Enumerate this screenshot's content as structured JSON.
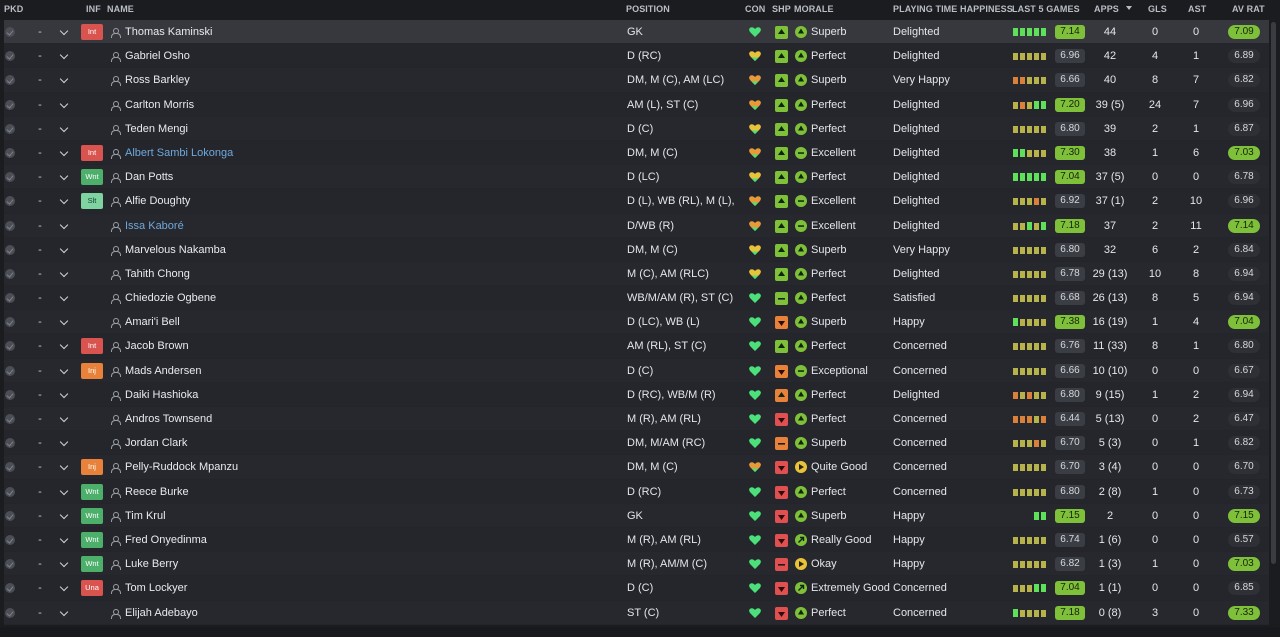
{
  "colors": {
    "green": "#7ec03a",
    "good_heart": "#4be07a",
    "ok_heart": "#e8c23a",
    "poor_heart": "#e89a3a",
    "red": "#e05050",
    "orange": "#e8823a",
    "yellow": "#e8c23a"
  },
  "headers": {
    "pkd": "PKD",
    "inf": "INF",
    "name": "NAME",
    "position": "POSITION",
    "con": "CON",
    "shp": "SHP",
    "morale": "MORALE",
    "playing_time": "PLAYING TIME HAPPINESS",
    "last5": "LAST 5 GAMES",
    "apps": "APPS",
    "gls": "GLS",
    "ast": "AST",
    "avrat": "AV RAT"
  },
  "players": [
    {
      "pkd": "-",
      "inf": "Int",
      "name": "Thomas Kaminski",
      "link": false,
      "position": "GK",
      "con": "good",
      "shp": "good",
      "morale_icon": "up",
      "morale": "Superb",
      "pth": "Delighted",
      "last5": [
        2,
        2,
        2,
        2,
        2
      ],
      "last5_rating": "7.14",
      "last5_hi": true,
      "apps": "44",
      "gls": "0",
      "ast": "0",
      "avrat": "7.09",
      "avrat_hi": true
    },
    {
      "pkd": "-",
      "inf": "",
      "name": "Gabriel Osho",
      "link": false,
      "position": "D (RC)",
      "con": "ok",
      "shp": "good",
      "morale_icon": "up",
      "morale": "Perfect",
      "pth": "Delighted",
      "last5": [
        1,
        1,
        1,
        1,
        1
      ],
      "last5_rating": "6.96",
      "last5_hi": false,
      "apps": "42",
      "gls": "4",
      "ast": "1",
      "avrat": "6.89",
      "avrat_hi": false
    },
    {
      "pkd": "-",
      "inf": "",
      "name": "Ross Barkley",
      "link": false,
      "position": "DM, M (C), AM (LC)",
      "con": "poor",
      "shp": "good",
      "morale_icon": "up",
      "morale": "Superb",
      "pth": "Very Happy",
      "last5": [
        0,
        0,
        1,
        1,
        1
      ],
      "last5_rating": "6.66",
      "last5_hi": false,
      "apps": "40",
      "gls": "8",
      "ast": "7",
      "avrat": "6.82",
      "avrat_hi": false
    },
    {
      "pkd": "-",
      "inf": "",
      "name": "Carlton Morris",
      "link": false,
      "position": "AM (L), ST (C)",
      "con": "poor",
      "shp": "good",
      "morale_icon": "up",
      "morale": "Perfect",
      "pth": "Delighted",
      "last5": [
        1,
        0,
        1,
        2,
        2
      ],
      "last5_rating": "7.20",
      "last5_hi": true,
      "apps": "39 (5)",
      "gls": "24",
      "ast": "7",
      "avrat": "6.96",
      "avrat_hi": false
    },
    {
      "pkd": "-",
      "inf": "",
      "name": "Teden Mengi",
      "link": false,
      "position": "D (C)",
      "con": "ok",
      "shp": "good",
      "morale_icon": "up",
      "morale": "Perfect",
      "pth": "Delighted",
      "last5": [
        1,
        1,
        1,
        1,
        1
      ],
      "last5_rating": "6.80",
      "last5_hi": false,
      "apps": "39",
      "gls": "2",
      "ast": "1",
      "avrat": "6.87",
      "avrat_hi": false
    },
    {
      "pkd": "-",
      "inf": "Int",
      "name": "Albert Sambi Lokonga",
      "link": true,
      "position": "DM, M (C)",
      "con": "poor",
      "shp": "good",
      "morale_icon": "flat",
      "morale": "Excellent",
      "pth": "Delighted",
      "last5": [
        2,
        2,
        1,
        1,
        1
      ],
      "last5_rating": "7.30",
      "last5_hi": true,
      "apps": "38",
      "gls": "1",
      "ast": "6",
      "avrat": "7.03",
      "avrat_hi": true
    },
    {
      "pkd": "-",
      "inf": "Wnt",
      "name": "Dan Potts",
      "link": false,
      "position": "D (LC)",
      "con": "ok",
      "shp": "good",
      "morale_icon": "up",
      "morale": "Perfect",
      "pth": "Delighted",
      "last5": [
        2,
        2,
        2,
        2,
        2
      ],
      "last5_rating": "7.04",
      "last5_hi": true,
      "apps": "37 (5)",
      "gls": "0",
      "ast": "0",
      "avrat": "6.78",
      "avrat_hi": false
    },
    {
      "pkd": "-",
      "inf": "Slt",
      "name": "Alfie Doughty",
      "link": false,
      "position": "D (L), WB (RL), M (L),…",
      "con": "poor",
      "shp": "good",
      "morale_icon": "flat",
      "morale": "Excellent",
      "pth": "Delighted",
      "last5": [
        1,
        1,
        1,
        0,
        1
      ],
      "last5_rating": "6.92",
      "last5_hi": false,
      "apps": "37 (1)",
      "gls": "2",
      "ast": "10",
      "avrat": "6.96",
      "avrat_hi": false
    },
    {
      "pkd": "-",
      "inf": "",
      "name": "Issa Kaboré",
      "link": true,
      "position": "D/WB (R)",
      "con": "poor",
      "shp": "good",
      "morale_icon": "flat",
      "morale": "Excellent",
      "pth": "Delighted",
      "last5": [
        1,
        1,
        2,
        1,
        2
      ],
      "last5_rating": "7.18",
      "last5_hi": true,
      "apps": "37",
      "gls": "2",
      "ast": "11",
      "avrat": "7.14",
      "avrat_hi": true
    },
    {
      "pkd": "-",
      "inf": "",
      "name": "Marvelous Nakamba",
      "link": false,
      "position": "DM, M (C)",
      "con": "ok",
      "shp": "good",
      "morale_icon": "up",
      "morale": "Superb",
      "pth": "Very Happy",
      "last5": [
        1,
        1,
        1,
        1,
        1
      ],
      "last5_rating": "6.80",
      "last5_hi": false,
      "apps": "32",
      "gls": "6",
      "ast": "2",
      "avrat": "6.84",
      "avrat_hi": false
    },
    {
      "pkd": "-",
      "inf": "",
      "name": "Tahith Chong",
      "link": false,
      "position": "M (C), AM (RLC)",
      "con": "ok",
      "shp": "good",
      "morale_icon": "up",
      "morale": "Perfect",
      "pth": "Delighted",
      "last5": [
        1,
        1,
        1,
        1,
        1
      ],
      "last5_rating": "6.78",
      "last5_hi": false,
      "apps": "29 (13)",
      "gls": "10",
      "ast": "8",
      "avrat": "6.94",
      "avrat_hi": false
    },
    {
      "pkd": "-",
      "inf": "",
      "name": "Chiedozie Ogbene",
      "link": false,
      "position": "WB/M/AM (R), ST (C)",
      "con": "good",
      "shp": "goodflat",
      "morale_icon": "up",
      "morale": "Perfect",
      "pth": "Satisfied",
      "last5": [
        1,
        1,
        1,
        1,
        1
      ],
      "last5_rating": "6.68",
      "last5_hi": false,
      "apps": "26 (13)",
      "gls": "8",
      "ast": "5",
      "avrat": "6.94",
      "avrat_hi": false
    },
    {
      "pkd": "-",
      "inf": "",
      "name": "Amari'i Bell",
      "link": false,
      "position": "D (LC), WB (L)",
      "con": "good",
      "shp": "orangedown",
      "morale_icon": "up",
      "morale": "Superb",
      "pth": "Happy",
      "last5": [
        2,
        1,
        1,
        1,
        1
      ],
      "last5_rating": "7.38",
      "last5_hi": true,
      "apps": "16 (19)",
      "gls": "1",
      "ast": "4",
      "avrat": "7.04",
      "avrat_hi": true
    },
    {
      "pkd": "-",
      "inf": "Int",
      "name": "Jacob Brown",
      "link": false,
      "position": "AM (RL), ST (C)",
      "con": "good",
      "shp": "greenup",
      "morale_icon": "up",
      "morale": "Perfect",
      "pth": "Concerned",
      "last5": [
        1,
        1,
        1,
        1,
        1
      ],
      "last5_rating": "6.76",
      "last5_hi": false,
      "apps": "11 (33)",
      "gls": "8",
      "ast": "1",
      "avrat": "6.80",
      "avrat_hi": false
    },
    {
      "pkd": "-",
      "inf": "Inj",
      "name": "Mads Andersen",
      "link": false,
      "position": "D (C)",
      "con": "good",
      "shp": "orangedown",
      "morale_icon": "flat",
      "morale": "Exceptional",
      "pth": "Concerned",
      "last5": [
        1,
        1,
        1,
        1,
        1
      ],
      "last5_rating": "6.66",
      "last5_hi": false,
      "apps": "10 (10)",
      "gls": "0",
      "ast": "0",
      "avrat": "6.67",
      "avrat_hi": false
    },
    {
      "pkd": "-",
      "inf": "",
      "name": "Daiki Hashioka",
      "link": false,
      "position": "D (RC), WB/M (R)",
      "con": "good",
      "shp": "orangeup",
      "morale_icon": "up",
      "morale": "Perfect",
      "pth": "Delighted",
      "last5": [
        0,
        1,
        0,
        1,
        1
      ],
      "last5_rating": "6.80",
      "last5_hi": false,
      "apps": "9 (15)",
      "gls": "1",
      "ast": "2",
      "avrat": "6.94",
      "avrat_hi": false
    },
    {
      "pkd": "-",
      "inf": "",
      "name": "Andros Townsend",
      "link": false,
      "position": "M (R), AM (RL)",
      "con": "good",
      "shp": "reddown",
      "morale_icon": "up",
      "morale": "Perfect",
      "pth": "Concerned",
      "last5": [
        0,
        0,
        0,
        1,
        0
      ],
      "last5_rating": "6.44",
      "last5_hi": false,
      "apps": "5 (13)",
      "gls": "0",
      "ast": "2",
      "avrat": "6.47",
      "avrat_hi": false
    },
    {
      "pkd": "-",
      "inf": "",
      "name": "Jordan Clark",
      "link": false,
      "position": "DM, M/AM (RC)",
      "con": "good",
      "shp": "orangeflat",
      "morale_icon": "up",
      "morale": "Superb",
      "pth": "Concerned",
      "last5": [
        1,
        1,
        1,
        0,
        1
      ],
      "last5_rating": "6.70",
      "last5_hi": false,
      "apps": "5 (3)",
      "gls": "0",
      "ast": "1",
      "avrat": "6.82",
      "avrat_hi": false
    },
    {
      "pkd": "-",
      "inf": "Inj",
      "name": "Pelly-Ruddock Mpanzu",
      "link": false,
      "position": "DM, M (C)",
      "con": "poor",
      "shp": "reddown",
      "morale_icon": "right",
      "morale": "Quite Good",
      "pth": "Concerned",
      "last5": [
        1,
        1,
        1,
        1,
        1
      ],
      "last5_rating": "6.70",
      "last5_hi": false,
      "apps": "3 (4)",
      "gls": "0",
      "ast": "0",
      "avrat": "6.70",
      "avrat_hi": false
    },
    {
      "pkd": "-",
      "inf": "Wnt",
      "name": "Reece Burke",
      "link": false,
      "position": "D (RC)",
      "con": "good",
      "shp": "reddown",
      "morale_icon": "up",
      "morale": "Perfect",
      "pth": "Concerned",
      "last5": [
        1,
        1,
        1,
        1,
        1
      ],
      "last5_rating": "6.80",
      "last5_hi": false,
      "apps": "2 (8)",
      "gls": "1",
      "ast": "0",
      "avrat": "6.73",
      "avrat_hi": false
    },
    {
      "pkd": "-",
      "inf": "Wnt",
      "name": "Tim Krul",
      "link": false,
      "position": "GK",
      "con": "good",
      "shp": "reddown",
      "morale_icon": "up",
      "morale": "Superb",
      "pth": "Happy",
      "last5": [
        2,
        2
      ],
      "last5_rating": "7.15",
      "last5_hi": true,
      "apps": "2",
      "gls": "0",
      "ast": "0",
      "avrat": "7.15",
      "avrat_hi": true
    },
    {
      "pkd": "-",
      "inf": "Wnt",
      "name": "Fred Onyedinma",
      "link": false,
      "position": "M (R), AM (RL)",
      "con": "good",
      "shp": "reddown",
      "morale_icon": "diag",
      "morale": "Really Good",
      "pth": "Happy",
      "last5": [
        1,
        1,
        1,
        1,
        1
      ],
      "last5_rating": "6.74",
      "last5_hi": false,
      "apps": "1 (6)",
      "gls": "0",
      "ast": "0",
      "avrat": "6.57",
      "avrat_hi": false
    },
    {
      "pkd": "-",
      "inf": "Wnt",
      "name": "Luke Berry",
      "link": false,
      "position": "M (R), AM/M (C)",
      "con": "good",
      "shp": "redflat",
      "morale_icon": "right",
      "morale": "Okay",
      "pth": "Happy",
      "last5": [
        1,
        1,
        1,
        1,
        1
      ],
      "last5_rating": "6.82",
      "last5_hi": false,
      "apps": "1 (3)",
      "gls": "1",
      "ast": "0",
      "avrat": "7.03",
      "avrat_hi": true
    },
    {
      "pkd": "-",
      "inf": "Una",
      "name": "Tom Lockyer",
      "link": false,
      "position": "D (C)",
      "con": "good",
      "shp": "reddown",
      "morale_icon": "diag",
      "morale": "Extremely Good",
      "pth": "Concerned",
      "last5": [
        1,
        1,
        1,
        2,
        2
      ],
      "last5_rating": "7.04",
      "last5_hi": true,
      "apps": "1 (1)",
      "gls": "0",
      "ast": "0",
      "avrat": "6.85",
      "avrat_hi": false
    },
    {
      "pkd": "-",
      "inf": "",
      "name": "Elijah Adebayo",
      "link": false,
      "position": "ST (C)",
      "con": "good",
      "shp": "reddown",
      "morale_icon": "up",
      "morale": "Perfect",
      "pth": "Concerned",
      "last5": [
        2,
        1,
        1,
        1,
        1
      ],
      "last5_rating": "7.18",
      "last5_hi": true,
      "apps": "0 (8)",
      "gls": "3",
      "ast": "0",
      "avrat": "7.33",
      "avrat_hi": true
    }
  ]
}
